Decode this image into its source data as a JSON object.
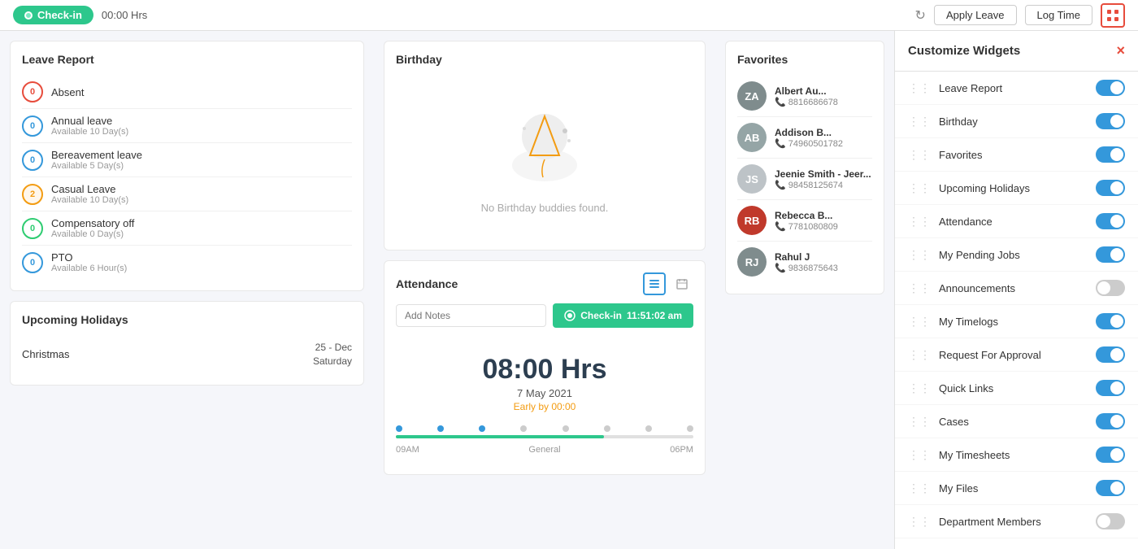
{
  "topbar": {
    "checkin_label": "Check-in",
    "hrs": "00:00 Hrs",
    "apply_leave_label": "Apply Leave",
    "log_time_label": "Log Time"
  },
  "leave_report": {
    "title": "Leave Report",
    "items": [
      {
        "count": "0",
        "name": "Absent",
        "avail": "",
        "badge_type": "red"
      },
      {
        "count": "0",
        "name": "Annual leave",
        "avail": "Available 10 Day(s)",
        "badge_type": "blue"
      },
      {
        "count": "0",
        "name": "Bereavement leave",
        "avail": "Available 5 Day(s)",
        "badge_type": "blue"
      },
      {
        "count": "2",
        "name": "Casual Leave",
        "avail": "Available 10 Day(s)",
        "badge_type": "orange"
      },
      {
        "count": "0",
        "name": "Compensatory off",
        "avail": "Available 0 Day(s)",
        "badge_type": "green"
      },
      {
        "count": "0",
        "name": "PTO",
        "avail": "Available 6 Hour(s)",
        "badge_type": "blue"
      }
    ]
  },
  "upcoming_holidays": {
    "title": "Upcoming Holidays",
    "items": [
      {
        "name": "Christmas",
        "date": "25 - Dec",
        "day": "Saturday"
      }
    ]
  },
  "birthday": {
    "title": "Birthday",
    "empty_text": "No Birthday buddies found."
  },
  "attendance": {
    "title": "Attendance",
    "notes_placeholder": "Add Notes",
    "checkin_btn": "Check-in",
    "checkin_time": "11:51:02 am",
    "hours": "08:00 Hrs",
    "date": "7 May 2021",
    "early": "Early by 00:00",
    "timeline_start": "09AM",
    "timeline_mid": "General",
    "timeline_end": "06PM",
    "fill_pct": "70"
  },
  "favorites": {
    "title": "Favorites",
    "items": [
      {
        "id": "ZY157",
        "name": "Albert Au...",
        "phone": "8816686678",
        "initials": "ZA",
        "color": "#7f8c8d"
      },
      {
        "id": "ZY156",
        "name": "Addison B...",
        "phone": "74960501782",
        "initials": "AB",
        "color": "#95a5a6"
      },
      {
        "id": "JS",
        "name": "Jeenie Smith - Jeer...",
        "phone": "98458125674",
        "initials": "JS",
        "color": "#bdc3c7"
      },
      {
        "id": "ZY134",
        "name": "Rebecca B...",
        "phone": "7781080809",
        "initials": "RB",
        "color": "#c0392b"
      },
      {
        "id": "ZY107",
        "name": "Rahul J",
        "phone": "9836875643",
        "initials": "RJ",
        "color": "#7f8c8d"
      }
    ]
  },
  "customize_widgets": {
    "title": "Customize Widgets",
    "items": [
      {
        "label": "Leave Report",
        "on": true
      },
      {
        "label": "Birthday",
        "on": true
      },
      {
        "label": "Favorites",
        "on": true
      },
      {
        "label": "Upcoming Holidays",
        "on": true
      },
      {
        "label": "Attendance",
        "on": true
      },
      {
        "label": "My Pending Jobs",
        "on": true
      },
      {
        "label": "Announcements",
        "on": false
      },
      {
        "label": "My Timelogs",
        "on": true
      },
      {
        "label": "Request For Approval",
        "on": true
      },
      {
        "label": "Quick Links",
        "on": true
      },
      {
        "label": "Cases",
        "on": true
      },
      {
        "label": "My Timesheets",
        "on": true
      },
      {
        "label": "My Files",
        "on": true
      },
      {
        "label": "Department Members",
        "on": false
      }
    ]
  }
}
